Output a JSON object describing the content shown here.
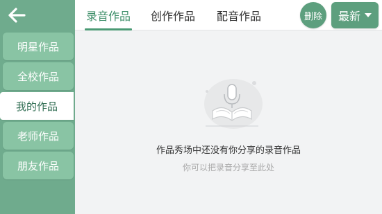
{
  "sidebar": {
    "items": [
      {
        "label": "明星作品"
      },
      {
        "label": "全校作品"
      },
      {
        "label": "我的作品"
      },
      {
        "label": "老师作品"
      },
      {
        "label": "朋友作品"
      }
    ],
    "active_index": 2
  },
  "topbar": {
    "tabs": [
      {
        "label": "录音作品"
      },
      {
        "label": "创作作品"
      },
      {
        "label": "配音作品"
      }
    ],
    "active_tab": 0,
    "delete_label": "删除",
    "sort_label": "最新"
  },
  "empty_state": {
    "title": "作品秀场中还没有你分享的录音作品",
    "subtitle": "你可以把录音分享至此处"
  },
  "colors": {
    "sidebar_bg": "#6fab8d",
    "sidebar_item_bg": "#89c4a4",
    "accent": "#4a9a74",
    "button_bg": "#5d9f7e",
    "content_bg": "#f2f3f4"
  },
  "icons": {
    "back": "arrow-left-icon",
    "sort_caret": "caret-down-icon",
    "empty": "book-microphone-icon"
  }
}
